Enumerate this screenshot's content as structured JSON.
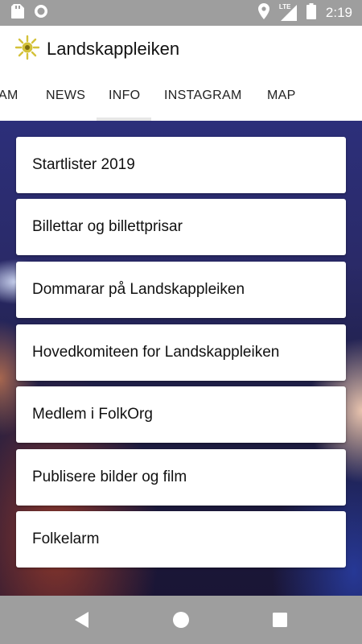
{
  "status_bar": {
    "time": "2:19",
    "network": "LTE",
    "icons": [
      "sd-card-icon",
      "record-icon",
      "location-icon",
      "signal-icon",
      "battery-icon"
    ]
  },
  "app": {
    "title": "Landskappleiken",
    "logo_color": "#d4c23a"
  },
  "tabs": [
    {
      "label": "AM"
    },
    {
      "label": "NEWS"
    },
    {
      "label": "INFO",
      "selected": true
    },
    {
      "label": "INSTAGRAM"
    },
    {
      "label": "MAP"
    }
  ],
  "menu": {
    "items": [
      {
        "label": "Startlister 2019"
      },
      {
        "label": "Billettar og billettprisar"
      },
      {
        "label": "Dommarar på Landskappleiken"
      },
      {
        "label": "Hovedkomiteen for Landskappleiken"
      },
      {
        "label": "Medlem i FolkOrg"
      },
      {
        "label": "Publisere bilder og film"
      },
      {
        "label": "Folkelarm"
      }
    ]
  },
  "nav_bar": {
    "buttons": [
      "back-icon",
      "home-icon",
      "recents-icon"
    ]
  }
}
